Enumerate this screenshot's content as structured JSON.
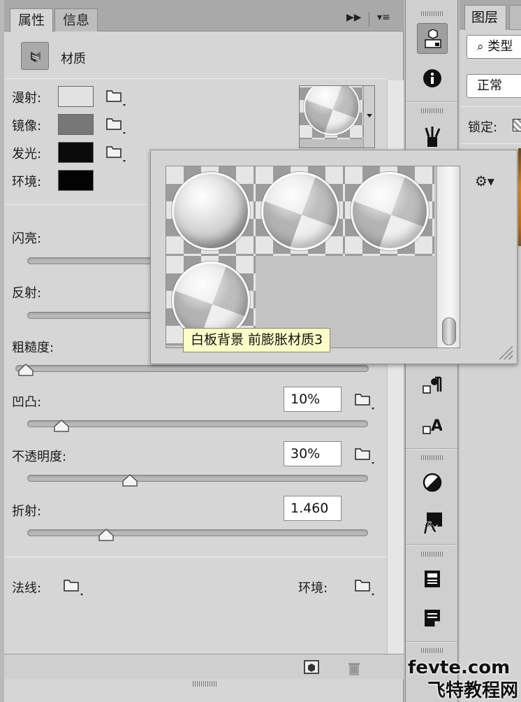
{
  "properties_panel": {
    "tabs": [
      "属性",
      "信息"
    ],
    "active_tab": "属性",
    "header_title": "材质",
    "colors": [
      {
        "label": "漫射:",
        "swatch": "#e2e2e2"
      },
      {
        "label": "镜像:",
        "swatch": "#777777"
      },
      {
        "label": "发光:",
        "swatch": "#0b0b0b"
      },
      {
        "label": "环境:",
        "swatch": "#030303"
      }
    ],
    "sliders": {
      "shine_label": "闪亮:",
      "reflection_label": "反射:",
      "roughness_label": "粗糙度:",
      "bump_label": "凹凸:",
      "bump_value": "10%",
      "opacity_label": "不透明度:",
      "opacity_value": "30%",
      "refraction_label": "折射:",
      "refraction_value": "1.460"
    },
    "footer": {
      "normal_label": "法线:",
      "environment_label": "环境:"
    }
  },
  "material_picker": {
    "tooltip": "白板背景 前膨胀材质3"
  },
  "layers_panel": {
    "tab": "图层",
    "search_kind": "类型",
    "blend_mode": "正常",
    "lock_label": "锁定:"
  },
  "watermark": {
    "line1": "fevte.com",
    "line2": "飞特教程网"
  },
  "accent_colors": {
    "panel_bg": "#d6d6d6",
    "tooltip_bg": "#fdfdc8"
  }
}
